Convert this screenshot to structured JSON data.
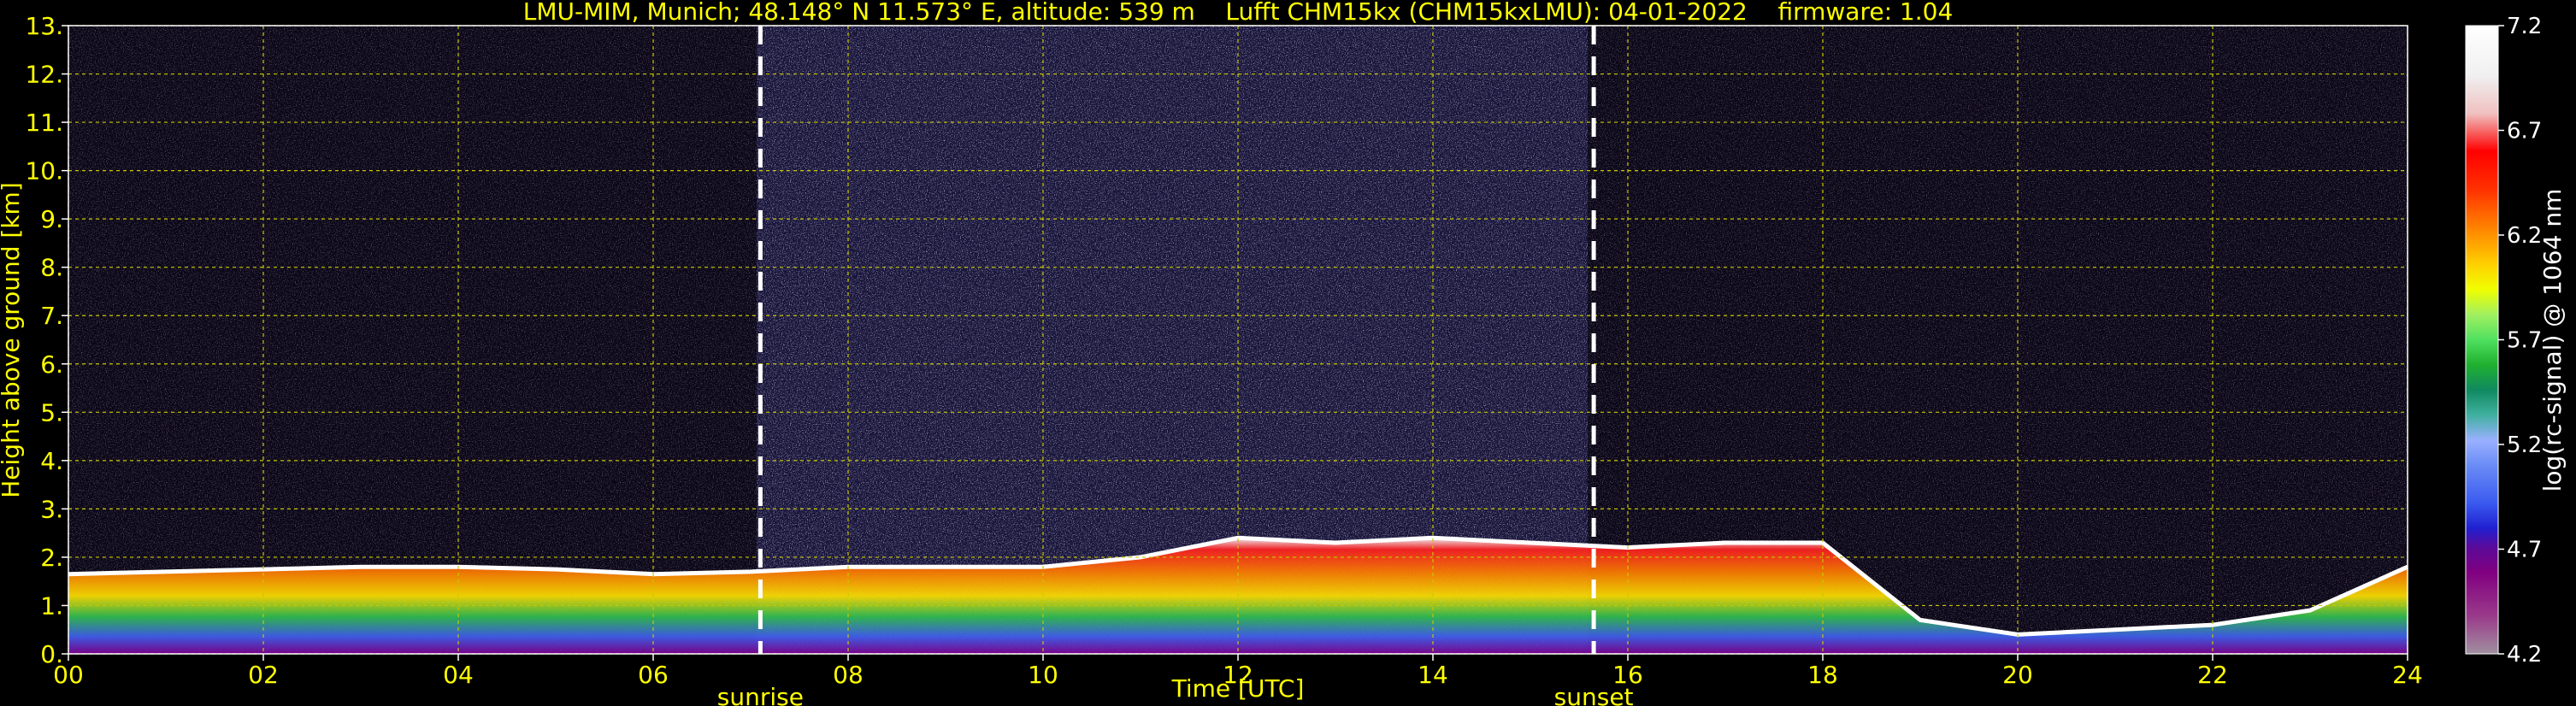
{
  "chart_data": {
    "type": "heatmap",
    "title": "LMU-MIM, Munich; 48.148° N 11.573° E, altitude: 539 m    Lufft CHM15kx (CHM15kxLMU): 04-01-2022    firmware: 1.04",
    "xlabel": "Time [UTC]",
    "ylabel": "Height above ground [km]",
    "xlim": [
      0,
      24
    ],
    "ylim": [
      0,
      13
    ],
    "x_ticks": [
      "00",
      "02",
      "04",
      "06",
      "08",
      "10",
      "12",
      "14",
      "16",
      "18",
      "20",
      "22",
      "24"
    ],
    "y_ticks": [
      "0.",
      "1.",
      "2.",
      "3.",
      "4.",
      "5.",
      "6.",
      "7.",
      "8.",
      "9.",
      "10.",
      "11.",
      "12.",
      "13."
    ],
    "grid": true,
    "annotations": [
      {
        "label": "sunrise",
        "x": 7.1
      },
      {
        "label": "sunset",
        "x": 15.65
      }
    ],
    "colorbar": {
      "label": "log(rc-signal) @ 1064 nm",
      "range": [
        4.2,
        7.2
      ],
      "ticks": [
        "4.2",
        "4.7",
        "5.2",
        "5.7",
        "6.2",
        "6.7",
        "7.2"
      ]
    },
    "boundary_layer_top_km": [
      [
        0.0,
        1.65
      ],
      [
        1.0,
        1.7
      ],
      [
        2.0,
        1.75
      ],
      [
        3.0,
        1.8
      ],
      [
        4.0,
        1.8
      ],
      [
        5.0,
        1.75
      ],
      [
        6.0,
        1.65
      ],
      [
        7.0,
        1.7
      ],
      [
        8.0,
        1.8
      ],
      [
        9.0,
        1.8
      ],
      [
        10.0,
        1.8
      ],
      [
        11.0,
        2.0
      ],
      [
        12.0,
        2.4
      ],
      [
        13.0,
        2.3
      ],
      [
        14.0,
        2.4
      ],
      [
        15.0,
        2.3
      ],
      [
        16.0,
        2.2
      ],
      [
        17.0,
        2.3
      ],
      [
        18.0,
        2.3
      ],
      [
        19.0,
        0.7
      ],
      [
        20.0,
        0.4
      ],
      [
        21.0,
        0.5
      ],
      [
        22.0,
        0.6
      ],
      [
        23.0,
        0.9
      ],
      [
        24.0,
        1.8
      ]
    ]
  }
}
